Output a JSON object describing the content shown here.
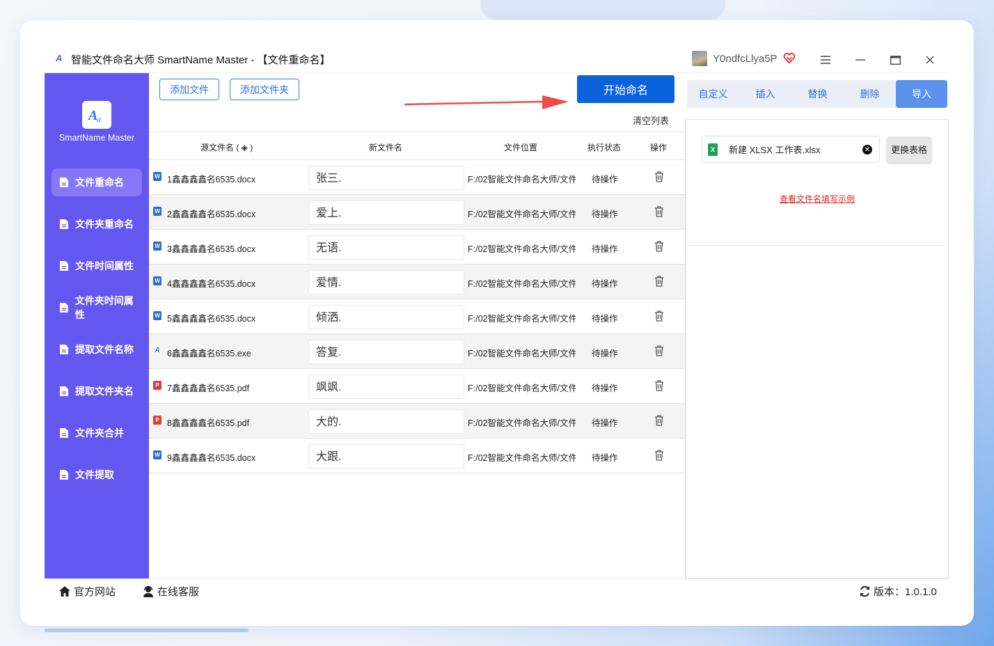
{
  "window": {
    "title": "智能文件命名大师 SmartName Master - 【文件重命名】",
    "username": "Y0ndfcLlya5P"
  },
  "sidebar": {
    "brand": "SmartName Master",
    "items": [
      {
        "label": "文件重命名",
        "active": true
      },
      {
        "label": "文件夹重命名"
      },
      {
        "label": "文件时间属性"
      },
      {
        "label": "文件夹时间属性"
      },
      {
        "label": "提取文件名称"
      },
      {
        "label": "提取文件夹名"
      },
      {
        "label": "文件夹合并"
      },
      {
        "label": "文件提取"
      }
    ]
  },
  "toolbar": {
    "add_file": "添加文件",
    "add_folder": "添加文件夹",
    "start": "开始命名",
    "clear": "清空列表"
  },
  "table": {
    "headers": {
      "source": "源文件名 ( ◈ )",
      "new": "新文件名",
      "location": "文件位置",
      "status": "执行状态",
      "action": "操作"
    },
    "rows": [
      {
        "type": "word",
        "source": "1鑫鑫鑫鑫名6535.docx",
        "new": "张三.",
        "location": "F:/02智能文件命名大师/文件,",
        "status": "待操作"
      },
      {
        "type": "word",
        "source": "2鑫鑫鑫鑫名6535.docx",
        "new": "爱上.",
        "location": "F:/02智能文件命名大师/文件,",
        "status": "待操作"
      },
      {
        "type": "word",
        "source": "3鑫鑫鑫鑫名6535.docx",
        "new": "无语.",
        "location": "F:/02智能文件命名大师/文件,",
        "status": "待操作"
      },
      {
        "type": "word",
        "source": "4鑫鑫鑫鑫名6535.docx",
        "new": "爱情.",
        "location": "F:/02智能文件命名大师/文件,",
        "status": "待操作"
      },
      {
        "type": "word",
        "source": "5鑫鑫鑫鑫名6535.docx",
        "new": "倾洒.",
        "location": "F:/02智能文件命名大师/文件,",
        "status": "待操作"
      },
      {
        "type": "exe",
        "source": "6鑫鑫鑫鑫名6535.exe",
        "new": "答复.",
        "location": "F:/02智能文件命名大师/文件,",
        "status": "待操作"
      },
      {
        "type": "pdf",
        "source": "7鑫鑫鑫鑫名6535.pdf",
        "new": "飒飒.",
        "location": "F:/02智能文件命名大师/文件,",
        "status": "待操作"
      },
      {
        "type": "pdf",
        "source": "8鑫鑫鑫鑫名6535.pdf",
        "new": "大的.",
        "location": "F:/02智能文件命名大师/文件,",
        "status": "待操作"
      },
      {
        "type": "word",
        "source": "9鑫鑫鑫鑫名6535.docx",
        "new": "大跟.",
        "location": "F:/02智能文件命名大师/文件,",
        "status": "待操作"
      }
    ]
  },
  "right_panel": {
    "tabs": [
      "自定义",
      "插入",
      "替换",
      "删除",
      "导入"
    ],
    "active_tab": "导入",
    "file_name": "新建 XLSX 工作表.xlsx",
    "swap_button": "更换表格",
    "example_link": "查看文件名填写示例"
  },
  "footer": {
    "website": "官方网站",
    "support": "在线客服",
    "version": "版本：1.0.1.0"
  },
  "colors": {
    "sidebar": "#6457f0",
    "primary": "#0c61dc",
    "accent_tab": "#5b93ec"
  }
}
